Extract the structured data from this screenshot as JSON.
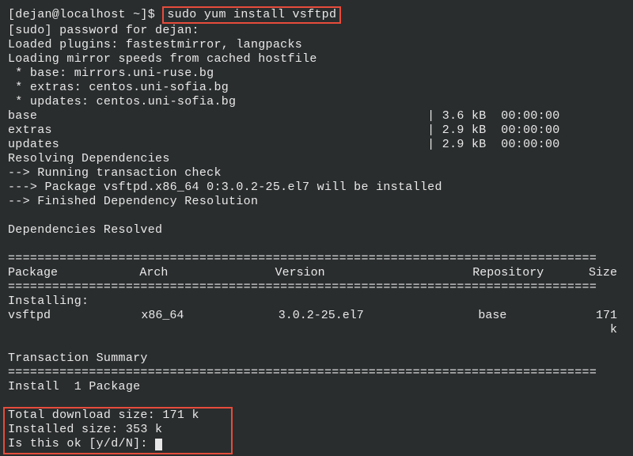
{
  "prompt": {
    "userhost": "[dejan@localhost ~]$",
    "command": "sudo yum install vsftpd"
  },
  "output": {
    "sudo_pw": "[sudo] password for dejan:",
    "plugins": "Loaded plugins: fastestmirror, langpacks",
    "mirror_load": "Loading mirror speeds from cached hostfile",
    "mirror_base": " * base: mirrors.uni-ruse.bg",
    "mirror_extras": " * extras: centos.uni-sofia.bg",
    "mirror_updates": " * updates: centos.uni-sofia.bg",
    "repo_base": "base                                                     | 3.6 kB  00:00:00",
    "repo_extras": "extras                                                   | 2.9 kB  00:00:00",
    "repo_updates": "updates                                                  | 2.9 kB  00:00:00",
    "resolving": "Resolving Dependencies",
    "txn_check": "--> Running transaction check",
    "pkg_install": "---> Package vsftpd.x86_64 0:3.0.2-25.el7 will be installed",
    "dep_done": "--> Finished Dependency Resolution",
    "deps_resolved": "Dependencies Resolved",
    "hr": "================================================================================",
    "hdr_pkg": " Package",
    "hdr_arch": "Arch",
    "hdr_ver": "Version",
    "hdr_repo": "Repository",
    "hdr_size": "Size",
    "installing": "Installing:",
    "row_pkg": " vsftpd",
    "row_arch": "x86_64",
    "row_ver": "3.0.2-25.el7",
    "row_repo": "base",
    "row_size": "171 k",
    "txn_summary": "Transaction Summary",
    "install_count": "Install  1 Package",
    "dl_size": "Total download size: 171 k",
    "inst_size": "Installed size: 353 k",
    "confirm": "Is this ok [y/d/N]: "
  }
}
